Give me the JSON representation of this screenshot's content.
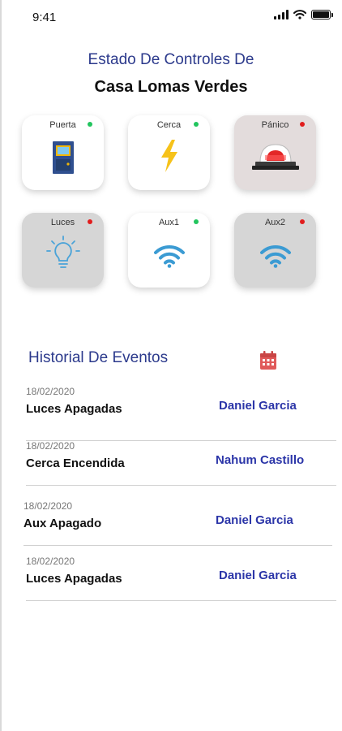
{
  "status_bar": {
    "time": "9:41",
    "signal_icon": "signal-icon",
    "wifi_icon": "wifi-icon",
    "battery_icon": "battery-icon"
  },
  "header": {
    "line1": "Estado De Controles De",
    "line2": "Casa Lomas Verdes"
  },
  "controls": [
    {
      "label": "Puerta",
      "status": "on",
      "icon": "door-icon"
    },
    {
      "label": "Cerca",
      "status": "on",
      "icon": "lightning-icon"
    },
    {
      "label": "Pánico",
      "status": "off",
      "icon": "alarm-button-icon"
    },
    {
      "label": "Luces",
      "status": "off",
      "icon": "lightbulb-icon"
    },
    {
      "label": "Aux1",
      "status": "on",
      "icon": "wifi-icon"
    },
    {
      "label": "Aux2",
      "status": "off",
      "icon": "wifi-icon"
    }
  ],
  "colors": {
    "status_on": "#22c55e",
    "status_off": "#e11d1d",
    "title_blue": "#2c3a8c",
    "user_blue": "#2b35a8",
    "calendar_red": "#e05a5a"
  },
  "history": {
    "title": "Historial De Eventos",
    "calendar_icon": "calendar-icon",
    "events": [
      {
        "date": "18/02/2020",
        "event": "Luces Apagadas",
        "user": "Daniel Garcia"
      },
      {
        "date": "18/02/2020",
        "event": "Cerca Encendida",
        "user": "Nahum Castillo"
      },
      {
        "date": "18/02/2020",
        "event": "Aux Apagado",
        "user": "Daniel Garcia"
      },
      {
        "date": "18/02/2020",
        "event": "Luces Apagadas",
        "user": "Daniel Garcia"
      }
    ]
  }
}
